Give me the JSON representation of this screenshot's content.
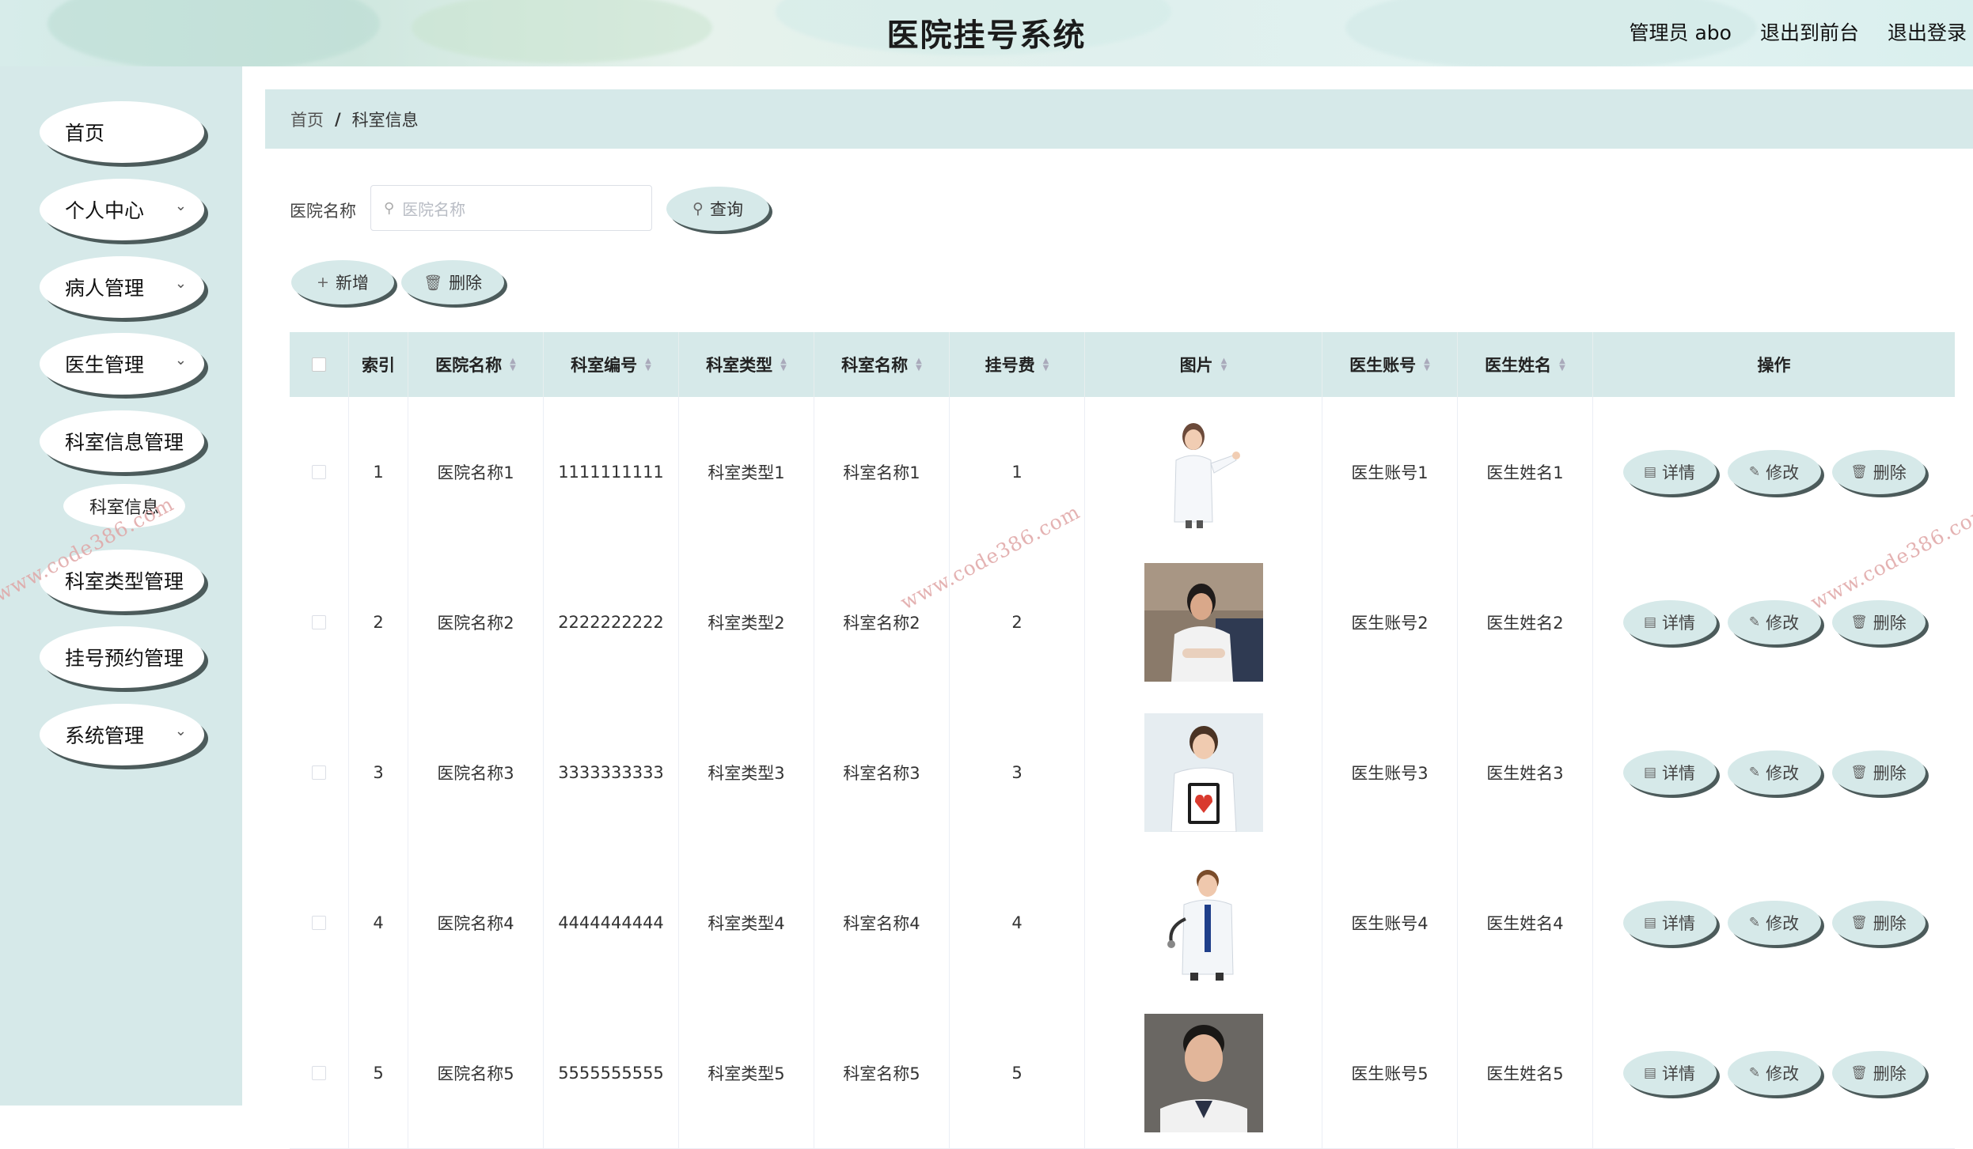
{
  "header": {
    "title": "医院挂号系统",
    "user_label": "管理员 abo",
    "front_link": "退出到前台",
    "logout_link": "退出登录"
  },
  "sidebar": {
    "items": [
      {
        "label": "首页",
        "has_arrow": false
      },
      {
        "label": "个人中心",
        "has_arrow": true
      },
      {
        "label": "病人管理",
        "has_arrow": true
      },
      {
        "label": "医生管理",
        "has_arrow": true
      },
      {
        "label": "科室信息管理",
        "has_arrow": true
      },
      {
        "label": "科室类型管理",
        "has_arrow": true
      },
      {
        "label": "挂号预约管理",
        "has_arrow": true
      },
      {
        "label": "系统管理",
        "has_arrow": true
      }
    ],
    "sub_item": "科室信息"
  },
  "breadcrumb": {
    "home": "首页",
    "separator": "/",
    "current": "科室信息"
  },
  "search": {
    "label": "医院名称",
    "placeholder": "医院名称",
    "query_button": "查询"
  },
  "toolbar": {
    "add_button": "新增",
    "delete_button": "删除"
  },
  "table": {
    "headers": {
      "index": "索引",
      "hospital": "医院名称",
      "dept_no": "科室编号",
      "dept_type": "科室类型",
      "dept_name": "科室名称",
      "fee": "挂号费",
      "image": "图片",
      "doctor_account": "医生账号",
      "doctor_name": "医生姓名",
      "actions": "操作"
    },
    "rows": [
      {
        "index": "1",
        "hospital": "医院名称1",
        "dept_no": "1111111111",
        "dept_type": "科室类型1",
        "dept_name": "科室名称1",
        "fee": "1",
        "doctor_account": "医生账号1",
        "doctor_name": "医生姓名1"
      },
      {
        "index": "2",
        "hospital": "医院名称2",
        "dept_no": "2222222222",
        "dept_type": "科室类型2",
        "dept_name": "科室名称2",
        "fee": "2",
        "doctor_account": "医生账号2",
        "doctor_name": "医生姓名2"
      },
      {
        "index": "3",
        "hospital": "医院名称3",
        "dept_no": "3333333333",
        "dept_type": "科室类型3",
        "dept_name": "科室名称3",
        "fee": "3",
        "doctor_account": "医生账号3",
        "doctor_name": "医生姓名3"
      },
      {
        "index": "4",
        "hospital": "医院名称4",
        "dept_no": "4444444444",
        "dept_type": "科室类型4",
        "dept_name": "科室名称4",
        "fee": "4",
        "doctor_account": "医生账号4",
        "doctor_name": "医生姓名4"
      },
      {
        "index": "5",
        "hospital": "医院名称5",
        "dept_no": "5555555555",
        "dept_type": "科室类型5",
        "dept_name": "科室名称5",
        "fee": "5",
        "doctor_account": "医生账号5",
        "doctor_name": "医生姓名5"
      }
    ],
    "row_actions": {
      "detail": "详情",
      "edit": "修改",
      "delete": "删除"
    }
  },
  "watermark": "www.code386.com",
  "colors": {
    "accent": "#d6e9e9",
    "shadow": "#4c5b5b",
    "watermark": "#e0a5a5"
  },
  "icons": {
    "search": "search-icon",
    "plus": "plus-icon",
    "trash": "trash-icon",
    "doc": "document-icon",
    "edit": "pencil-icon",
    "chevron": "chevron-down-icon"
  }
}
